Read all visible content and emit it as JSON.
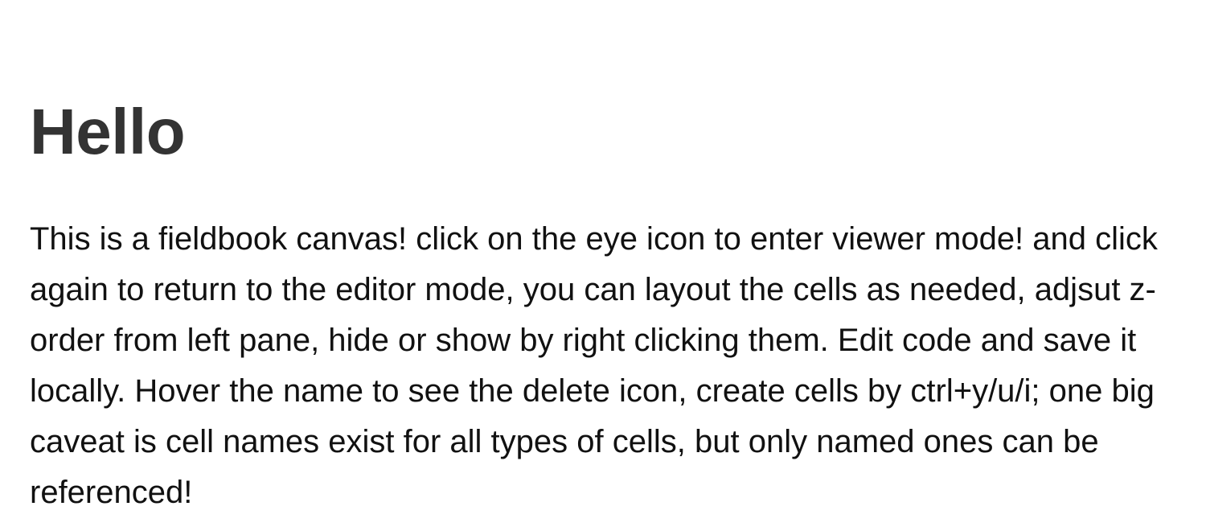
{
  "document": {
    "heading": "Hello",
    "paragraph": "This is a fieldbook canvas! click on the eye icon to enter viewer mode! and click again to return to the editor mode, you can layout the cells as needed, adjsut z-order from left pane, hide or show by right clicking them. Edit code and save it locally. Hover the name to see the delete icon, create cells by ctrl+y/u/i; one big caveat is cell names exist for all types of cells, but only named ones can be referenced!"
  }
}
